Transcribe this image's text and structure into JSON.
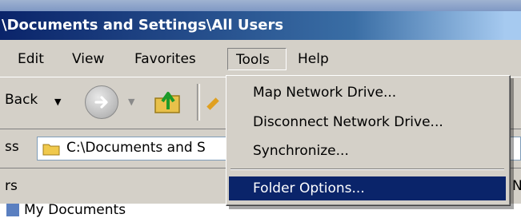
{
  "window": {
    "title": "\\Documents and Settings\\All Users"
  },
  "menubar": {
    "items": [
      "Edit",
      "View",
      "Favorites",
      "Tools",
      "Help"
    ],
    "open_menu": "Tools"
  },
  "toolbar": {
    "back_label": "Back",
    "icons": [
      "back-arrow-icon",
      "forward-arrow-icon",
      "up-folder-icon"
    ]
  },
  "address": {
    "label": "ss",
    "value": "C:\\Documents and S"
  },
  "panel": {
    "label": "rs",
    "right_letter": "N",
    "first_item": "My Documents"
  },
  "tools_menu": {
    "items": [
      {
        "label": "Map Network Drive..."
      },
      {
        "label": "Disconnect Network Drive..."
      },
      {
        "label": "Synchronize..."
      },
      {
        "label": "Folder Options...",
        "selected": true
      }
    ]
  },
  "colors": {
    "title_bar": "#0a246a",
    "selection": "#0a246a",
    "chrome": "#d4d0c8",
    "desktop_bg": "#ffff66"
  }
}
